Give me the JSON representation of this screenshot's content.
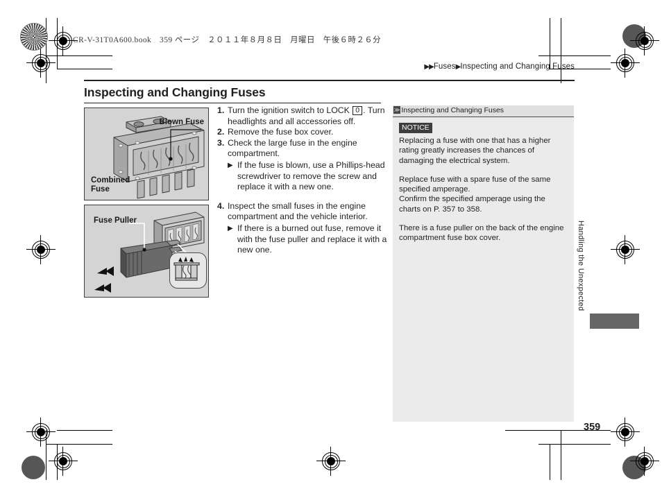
{
  "header": {
    "book_line": "CR-V-31T0A600.book　359 ページ　２０１１年８月８日　月曜日　午後６時２６分"
  },
  "breadcrumb": {
    "arrow_double": "▶▶",
    "arrow_single": "▶",
    "level1": "Fuses",
    "level2": "Inspecting and Changing Fuses"
  },
  "page_title": "Inspecting and Changing Fuses",
  "figures": [
    {
      "name": "combined-fuse-illustration",
      "labels": {
        "blown_fuse": "Blown Fuse",
        "combined_fuse": "Combined\nFuse"
      }
    },
    {
      "name": "fuse-puller-illustration",
      "labels": {
        "fuse_puller": "Fuse Puller"
      }
    }
  ],
  "steps": [
    {
      "num": "1.",
      "text_before": "Turn the ignition switch to LOCK ",
      "lock_symbol": "0",
      "text_after": ". Turn headlights and all accessories off."
    },
    {
      "num": "2.",
      "text": "Remove the fuse box cover."
    },
    {
      "num": "3.",
      "text": "Check the large fuse in the engine compartment.",
      "sub_arrow": "▶",
      "sub": "If the fuse is blown, use a Phillips-head screwdriver to remove the screw and replace it with a new one."
    },
    {
      "num": "4.",
      "text": "Inspect the small fuses in the engine compartment and the vehicle interior.",
      "sub_arrow": "▶",
      "sub": "If there is a burned out fuse, remove it with the fuse puller and replace it with a new one."
    }
  ],
  "panel": {
    "head_icon": "≫",
    "head_title": "Inspecting and Changing Fuses",
    "notice_badge": "NOTICE",
    "paragraphs": [
      "Replacing a fuse with one that has a higher rating greatly increases the chances of damaging the electrical system.",
      "Replace fuse with a spare fuse of the same specified amperage.\nConfirm the specified amperage using the charts on P. 357 to 358.",
      "There is a fuse puller on the back of the engine compartment fuse box cover."
    ]
  },
  "side_tab": "Handling the Unexpected",
  "page_number": "359",
  "colors": {
    "text": "#231f20",
    "panel_bg": "#ebebeb",
    "figure_bg": "#d4d4d4",
    "tab_block": "#666666",
    "notice_badge_bg": "#3e3e3e"
  }
}
